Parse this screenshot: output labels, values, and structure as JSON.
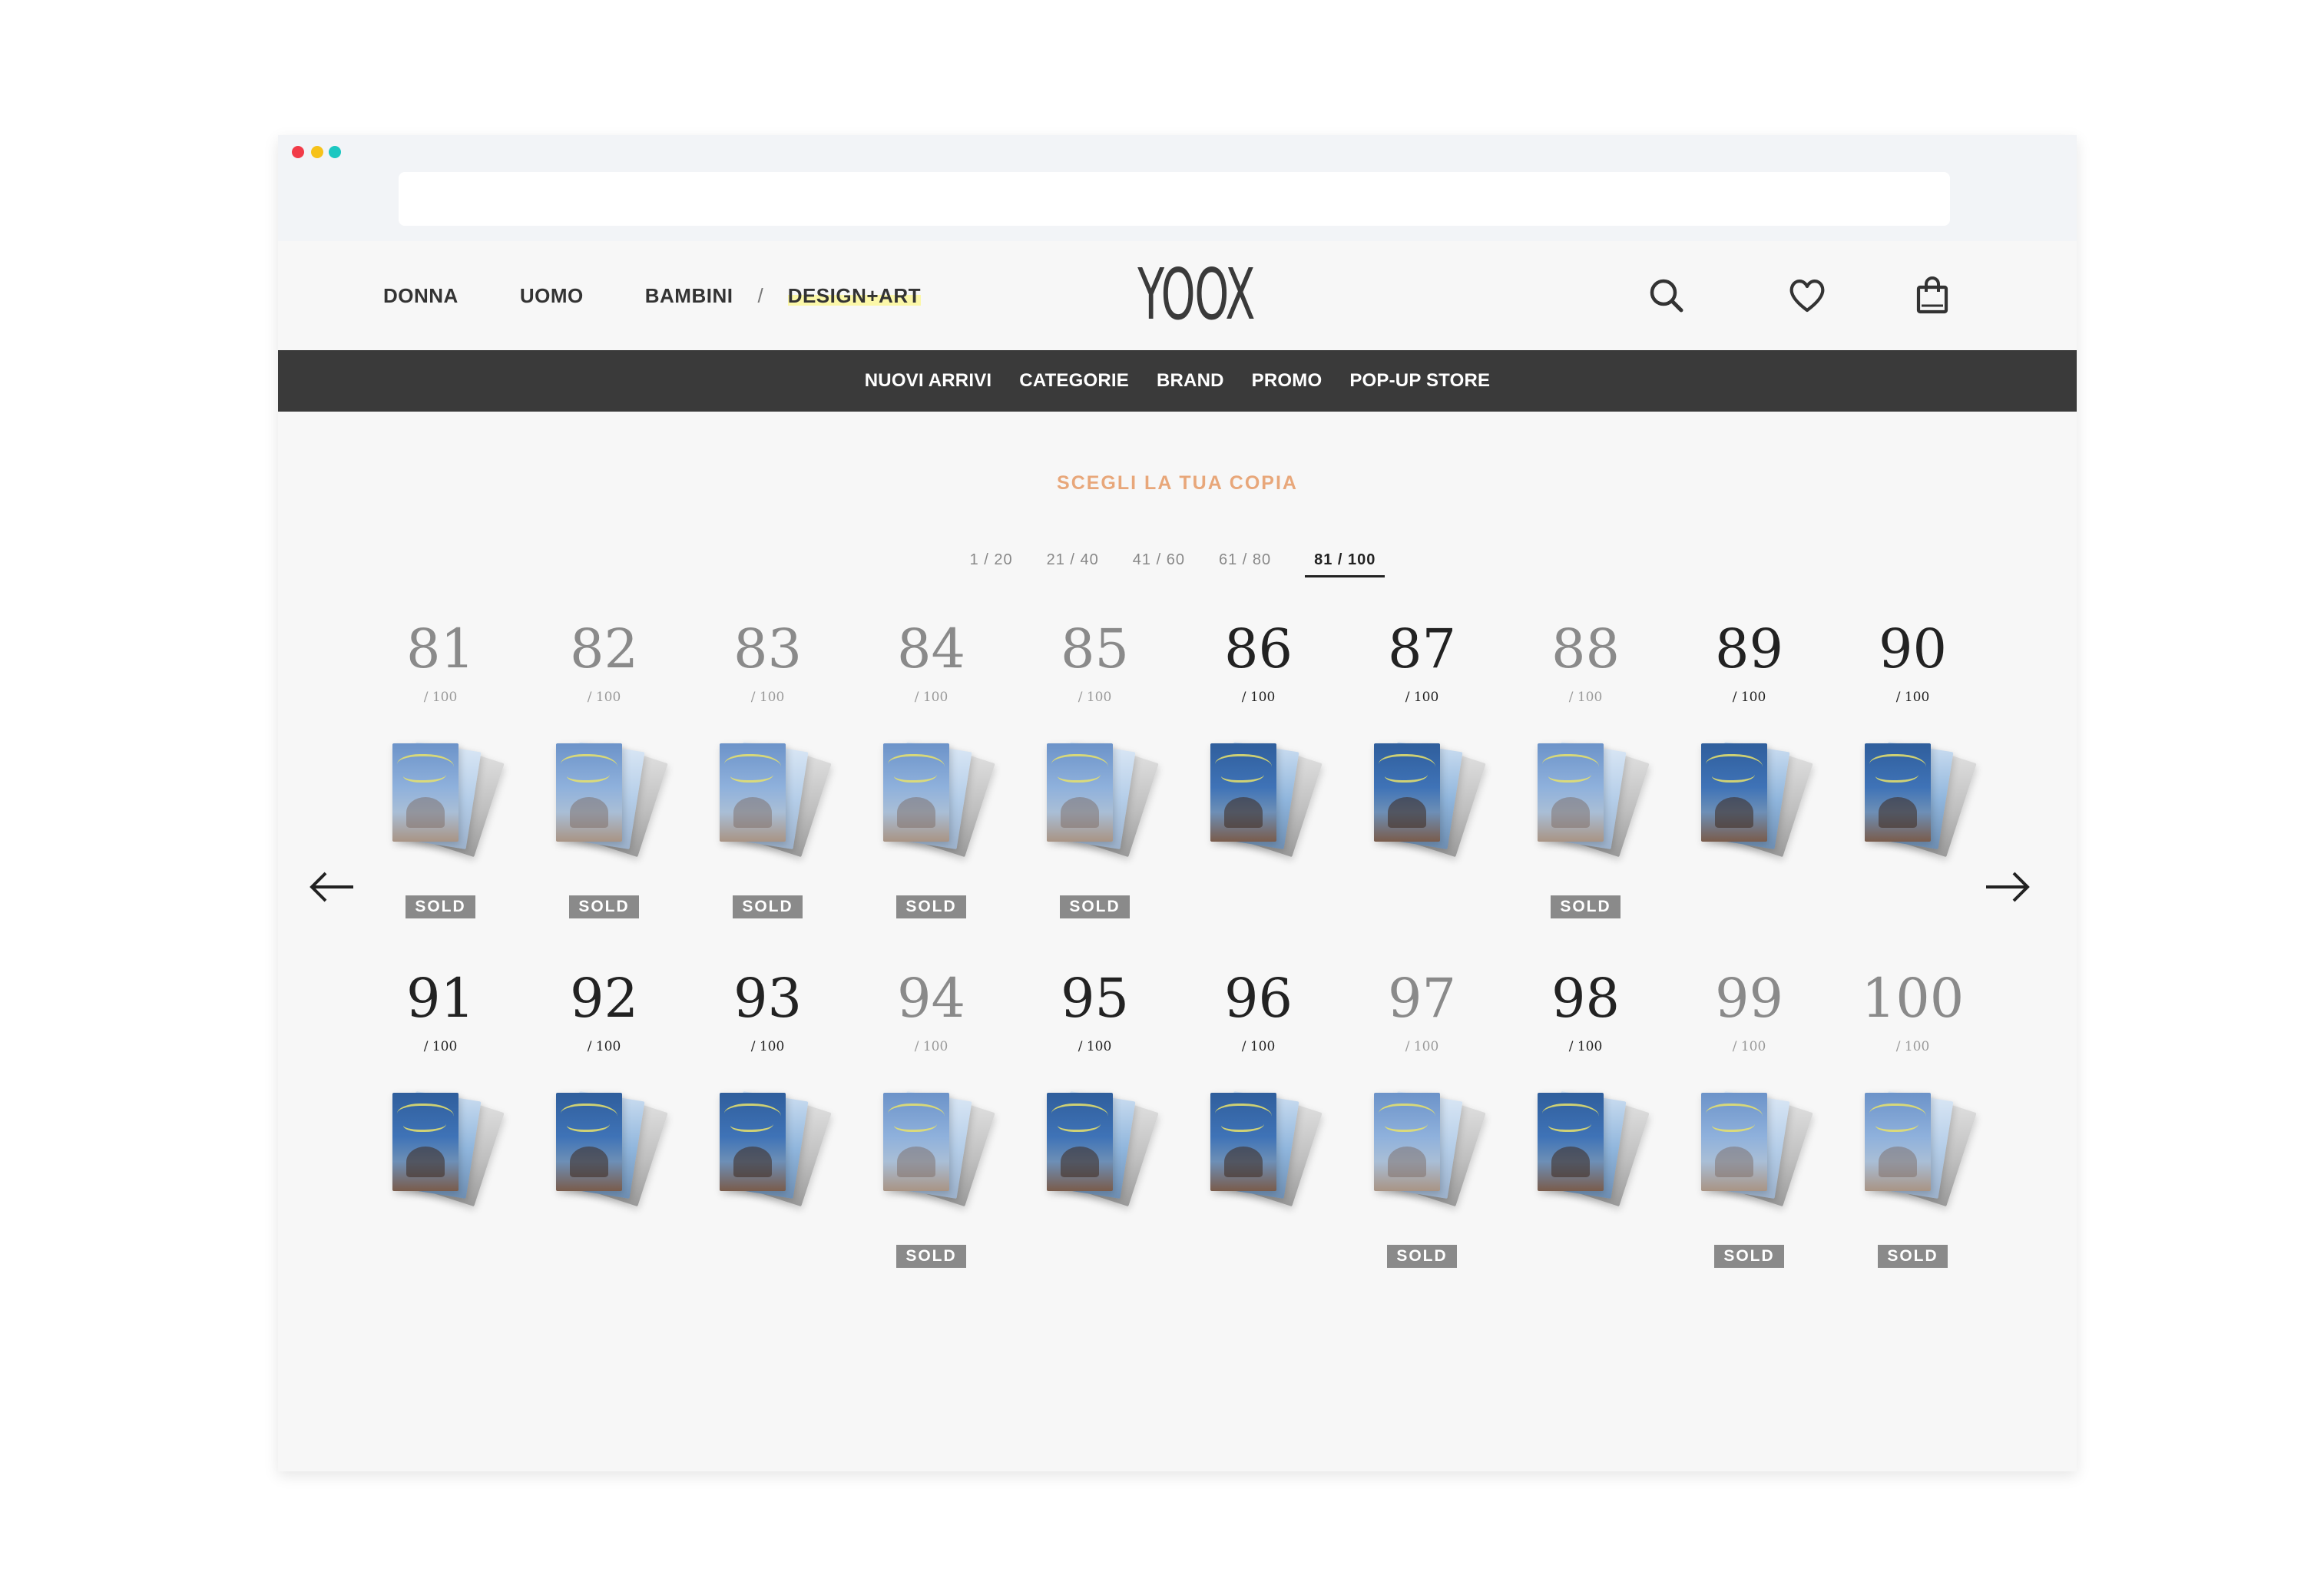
{
  "header": {
    "nav": [
      "DONNA",
      "UOMO",
      "BAMBINI"
    ],
    "separator": "/",
    "highlight": "DESIGN+ART",
    "logo": "YOOX",
    "icons": [
      "search-icon",
      "heart-icon",
      "shopping-bag-icon"
    ]
  },
  "menu": [
    "NUOVI ARRIVI",
    "CATEGORIE",
    "BRAND",
    "PROMO",
    "POP-UP STORE"
  ],
  "content": {
    "heading": "SCEGLI LA TUA COPIA",
    "pages": [
      "1 / 20",
      "21 / 40",
      "41 / 60",
      "61 / 80",
      "81 / 100"
    ],
    "active_page": "81 / 100",
    "denominator": "/ 100",
    "sold_label": "SOLD",
    "copies": [
      {
        "number": "81",
        "sold": true
      },
      {
        "number": "82",
        "sold": true
      },
      {
        "number": "83",
        "sold": true
      },
      {
        "number": "84",
        "sold": true
      },
      {
        "number": "85",
        "sold": true
      },
      {
        "number": "86",
        "sold": false
      },
      {
        "number": "87",
        "sold": false
      },
      {
        "number": "88",
        "sold": true
      },
      {
        "number": "89",
        "sold": false
      },
      {
        "number": "90",
        "sold": false
      },
      {
        "number": "91",
        "sold": false
      },
      {
        "number": "92",
        "sold": false
      },
      {
        "number": "93",
        "sold": false
      },
      {
        "number": "94",
        "sold": true
      },
      {
        "number": "95",
        "sold": false
      },
      {
        "number": "96",
        "sold": false
      },
      {
        "number": "97",
        "sold": true
      },
      {
        "number": "98",
        "sold": false
      },
      {
        "number": "99",
        "sold": true
      },
      {
        "number": "100",
        "sold": true
      }
    ]
  },
  "colors": {
    "accent_heading": "#e8a77a",
    "navbar_bg": "#3a3a3a",
    "sold_badge": "#8a8a8a",
    "highlight": "#fbf7a8"
  }
}
